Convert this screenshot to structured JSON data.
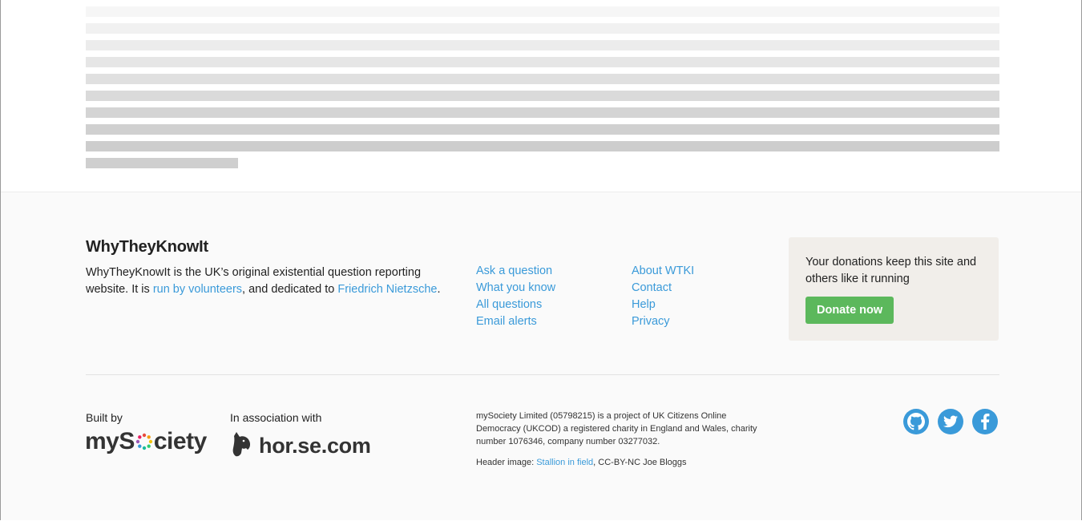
{
  "footer": {
    "brand_title": "WhyTheyKnowIt",
    "description": {
      "part1": "WhyTheyKnowIt is the UK’s original existential question reporting website. It is ",
      "link1": "run by volunteers",
      "part2": ", and dedicated to ",
      "link2": "Friedrich Nietzsche",
      "part3": "."
    },
    "links_col1": [
      "Ask a question",
      "What you know",
      "All questions",
      "Email alerts"
    ],
    "links_col2": [
      "About WTKI",
      "Contact",
      "Help",
      "Privacy"
    ],
    "donate": {
      "text": "Your donations keep this site and others like it running",
      "button": "Donate now",
      "button_color": "#5cb85c"
    },
    "credits": {
      "built_by_label": "Built by",
      "built_by_logo": "mySociety",
      "association_label": "In association with",
      "association_logo": "hor.se.com"
    },
    "legal": {
      "company": "mySociety Limited (05798215) is a project of UK Citizens Online Democracy (UKCOD) a registered charity in England and Wales, charity number 1076346, company number 03277032.",
      "header_image_prefix": "Header image: ",
      "header_image_link": "Stallion in field",
      "header_image_suffix": ", CC-BY-NC Joe Bloggs"
    },
    "social_icons": [
      "github-icon",
      "twitter-icon",
      "facebook-icon"
    ],
    "link_color": "#3a9ad9"
  }
}
